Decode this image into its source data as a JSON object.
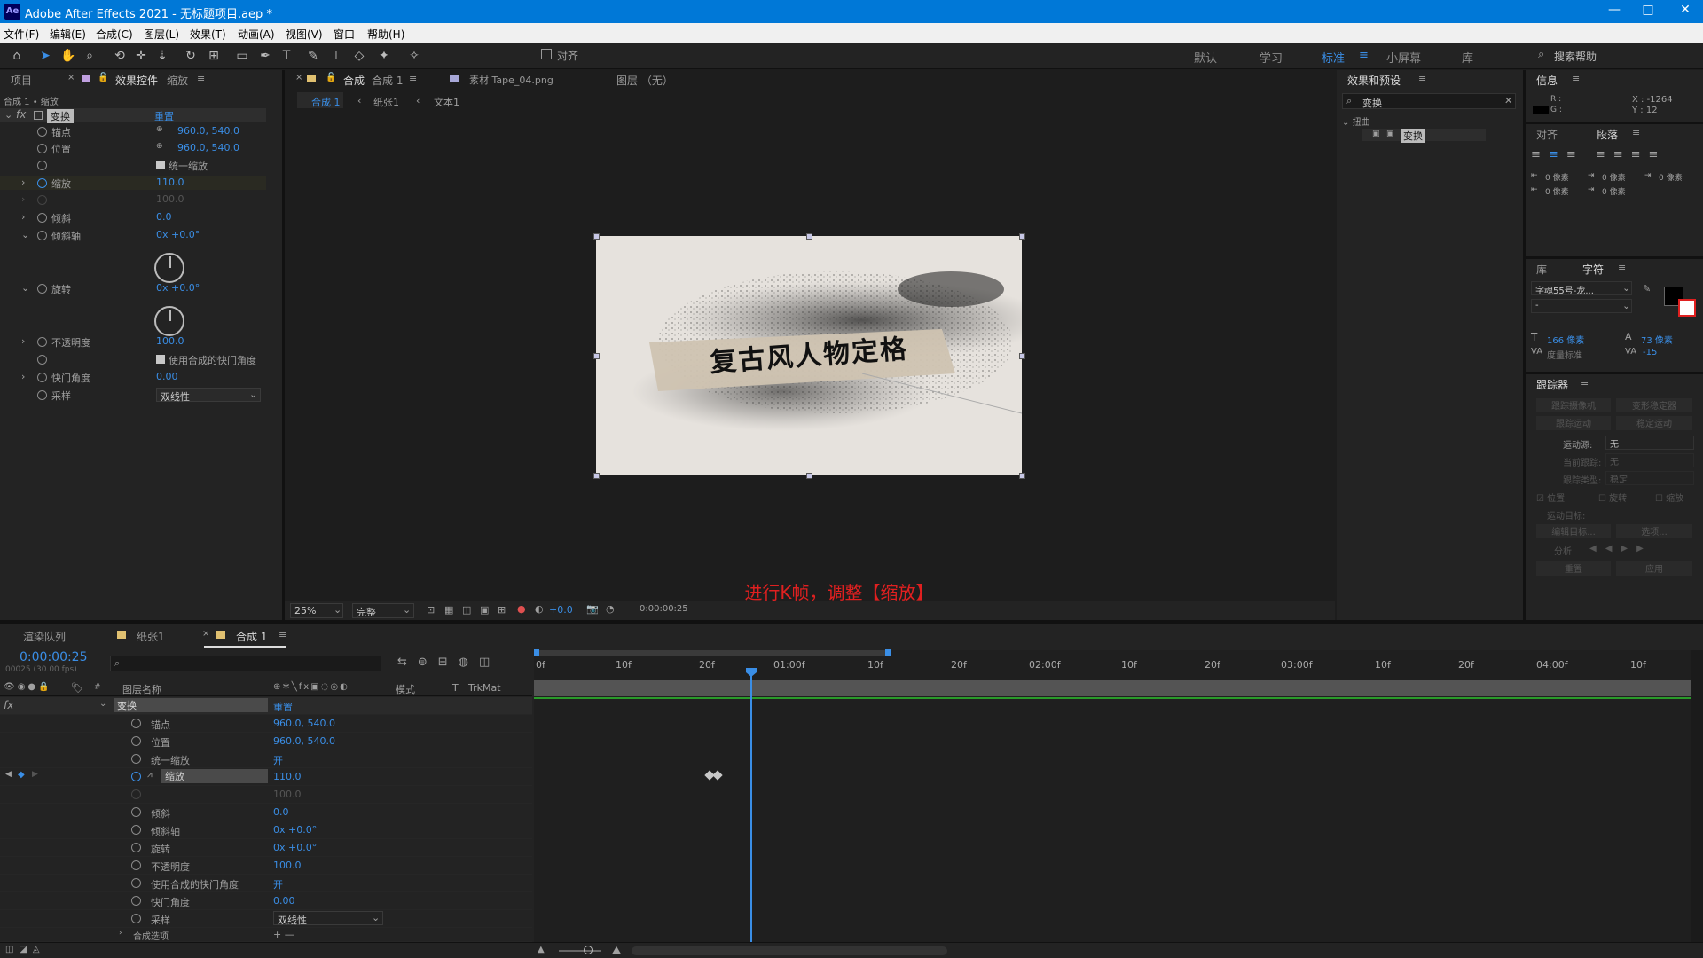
{
  "window": {
    "app_icon": "Ae",
    "title": "Adobe After Effects 2021 - 无标题项目.aep *",
    "min": "—",
    "max": "□",
    "close": "✕"
  },
  "menu": [
    "文件(F)",
    "编辑(E)",
    "合成(C)",
    "图层(L)",
    "效果(T)",
    "动画(A)",
    "视图(V)",
    "窗口",
    "帮助(H)"
  ],
  "toolbar": {
    "snap_label": "对齐",
    "workspaces": [
      "默认",
      "学习",
      "标准",
      "小屏幕",
      "库"
    ],
    "active_workspace": "标准",
    "search_help": "搜索帮助"
  },
  "effects_panel": {
    "tab_project": "项目",
    "tab_effects": "效果控件",
    "tab_effects_layer": "缩放",
    "breadcrumb": "合成 1 • 缩放",
    "fx_label": "fx",
    "effect_name": "变换",
    "reset": "重置",
    "props": [
      {
        "name": "锚点",
        "value": "960.0, 540.0"
      },
      {
        "name": "位置",
        "value": "960.0, 540.0"
      },
      {
        "name": "",
        "value": "统一缩放"
      },
      {
        "name": "缩放",
        "value": "110.0"
      },
      {
        "name": "",
        "value": "100.0"
      },
      {
        "name": "倾斜",
        "value": "0.0"
      },
      {
        "name": "倾斜轴",
        "value": "0x +0.0°"
      },
      {
        "name": "旋转",
        "value": "0x +0.0°"
      },
      {
        "name": "不透明度",
        "value": "100.0"
      },
      {
        "name": "",
        "value": "使用合成的快门角度"
      },
      {
        "name": "快门角度",
        "value": "0.00"
      },
      {
        "name": "采样",
        "value": "双线性"
      }
    ]
  },
  "comp_panel": {
    "tab_comp_prefix": "合成",
    "tab_comp": "合成 1",
    "tab_footage": "素材 Tape_04.png",
    "tab_layer": "图层 （无）",
    "crumbs": [
      "合成 1",
      "纸张1",
      "文本1"
    ],
    "preview_text": "复古风人物定格",
    "subtitle": "进行K帧，调整【缩放】",
    "zoom": "25%",
    "quality": "完整",
    "exposure": "+0.0",
    "timecode": "0:00:00:25"
  },
  "effects_presets": {
    "title": "效果和预设",
    "search": "变换",
    "category": "扭曲",
    "item": "变换"
  },
  "info": {
    "title": "信息",
    "r": "R :",
    "g": "G :",
    "x": "X : -1264",
    "y": "Y : 12"
  },
  "paragraph": {
    "tab_align": "对齐",
    "tab_para": "段落",
    "px0": "0 像素"
  },
  "character": {
    "tab_lib": "库",
    "tab_char": "字符",
    "font": "字魂55号-龙...",
    "style": "-",
    "size": "166 像素",
    "leading": "73 像素",
    "kerning": "度量标准",
    "tracking": "-15"
  },
  "tracker": {
    "title": "跟踪器",
    "track_camera": "跟踪摄像机",
    "warp_stab": "变形稳定器",
    "track_motion": "跟踪运动",
    "stab_motion": "稳定运动",
    "source_label": "运动源:",
    "source_value": "无",
    "current_track": "当前跟踪:",
    "current_value": "无",
    "track_type": "跟踪类型:",
    "type_value": "稳定",
    "pos": "位置",
    "rot": "旋转",
    "scale": "缩放",
    "target": "运动目标:",
    "edit_target": "编辑目标...",
    "options": "选项...",
    "analyze": "分析",
    "reset": "重置",
    "apply": "应用"
  },
  "timeline": {
    "tab_render": "渲染队列",
    "tab_paper": "纸张1",
    "tab_comp": "合成 1",
    "timecode": "0:00:00:25",
    "frame_info": "00025 (30.00 fps)",
    "col_layer": "图层名称",
    "col_mode": "模式",
    "col_t": "T",
    "col_trkmat": "TrkMat",
    "effect_name": "变换",
    "reset": "重置",
    "props": [
      {
        "name": "锚点",
        "value": "960.0, 540.0"
      },
      {
        "name": "位置",
        "value": "960.0, 540.0"
      },
      {
        "name": "统一缩放",
        "value": "开"
      },
      {
        "name": "缩放",
        "value": "110.0"
      },
      {
        "name": "",
        "value": "100.0"
      },
      {
        "name": "倾斜",
        "value": "0.0"
      },
      {
        "name": "倾斜轴",
        "value": "0x +0.0°"
      },
      {
        "name": "旋转",
        "value": "0x +0.0°"
      },
      {
        "name": "不透明度",
        "value": "100.0"
      },
      {
        "name": "使用合成的快门角度",
        "value": "开"
      },
      {
        "name": "快门角度",
        "value": "0.00"
      },
      {
        "name": "采样",
        "value": "双线性"
      },
      {
        "name": "合成选项",
        "value": "+ —"
      }
    ],
    "ruler": [
      "0f",
      "10f",
      "20f",
      "01:00f",
      "10f",
      "20f",
      "02:00f",
      "10f",
      "20f",
      "03:00f",
      "10f",
      "20f",
      "04:00f",
      "10f"
    ]
  }
}
